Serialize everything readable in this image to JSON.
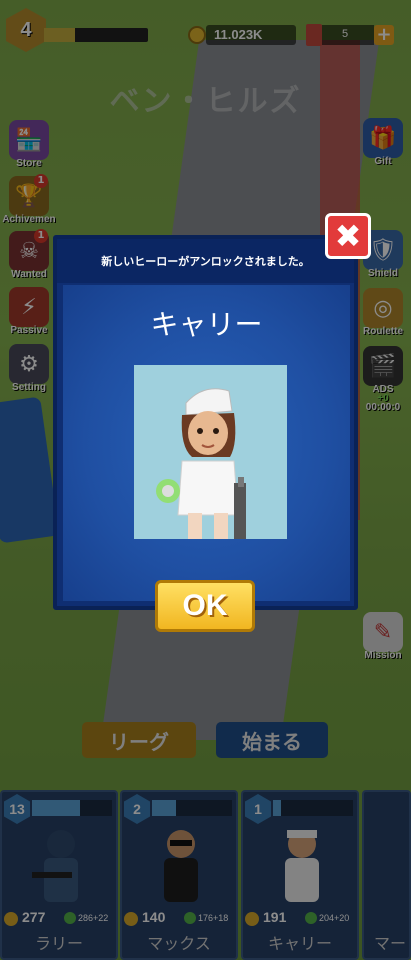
{
  "topbar": {
    "level": "4",
    "xp_progress": 0.3,
    "coins": "11.023K",
    "tickets": "5",
    "plus": "+"
  },
  "map_title": "ベン・ヒルズ",
  "left_menu": [
    {
      "label": "Store",
      "icon": "store-icon",
      "badge": ""
    },
    {
      "label": "Achivemen",
      "icon": "trophy-icon",
      "badge": "1"
    },
    {
      "label": "Wanted",
      "icon": "wanted-icon",
      "badge": "1"
    },
    {
      "label": "Passive",
      "icon": "passive-icon",
      "badge": ""
    },
    {
      "label": "Setting",
      "icon": "gear-icon",
      "badge": ""
    }
  ],
  "right_menu": [
    {
      "label": "Gift",
      "icon": "gift-icon"
    },
    {
      "label": "Shield",
      "icon": "shield-icon"
    },
    {
      "label": "Roulette",
      "icon": "roulette-icon"
    },
    {
      "label": "ADS",
      "icon": "video-icon",
      "extra": "+0",
      "timer": "00:00:0"
    },
    {
      "label": "Mission",
      "icon": "mission-icon"
    }
  ],
  "modal": {
    "header": "新しいヒーローがアンロックされました。",
    "hero_name": "キャリー",
    "ok_label": "OK",
    "close_symbol": "✖"
  },
  "buttons": {
    "league": "リーグ",
    "start": "始まる"
  },
  "heroes": [
    {
      "level": "13",
      "progress": 0.6,
      "power": "277",
      "hp": "286+22",
      "name": "ラリー"
    },
    {
      "level": "2",
      "progress": 0.3,
      "power": "140",
      "hp": "176+18",
      "name": "マックス"
    },
    {
      "level": "1",
      "progress": 0.1,
      "power": "191",
      "hp": "204+20",
      "name": "キャリー"
    },
    {
      "level": "",
      "progress": 0,
      "power": "",
      "hp": "",
      "name": "マー"
    }
  ],
  "colors": {
    "modal_bg": "#0f2e72",
    "ok_button": "#f1b621",
    "close_button": "#e23b3b"
  }
}
